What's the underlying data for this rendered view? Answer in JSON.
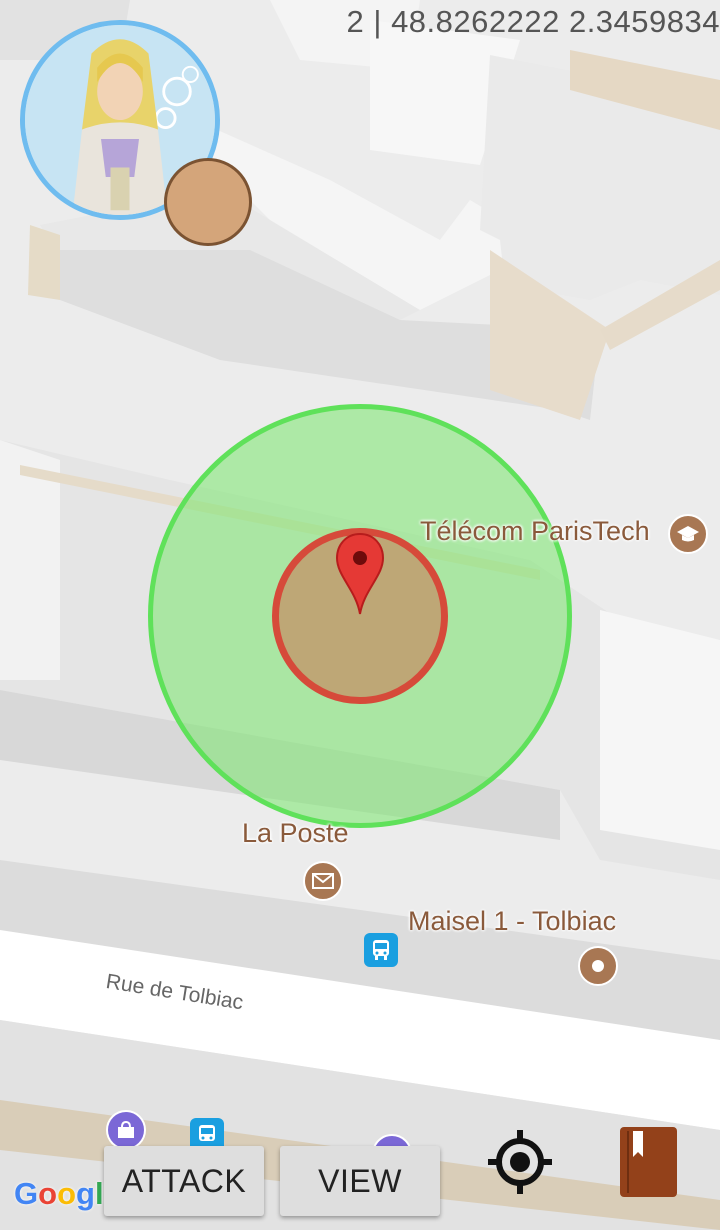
{
  "status": {
    "coords": "2 | 48.8262222 2.3459834"
  },
  "map": {
    "pois": [
      {
        "label": "Télécom ParisTech",
        "icon": "graduation-cap-icon"
      },
      {
        "label": "La Poste",
        "icon": "mail-icon"
      },
      {
        "label": "Maisel 1 - Tolbiac",
        "icon": "place-dot-icon"
      }
    ],
    "street": "Rue de Tolbiac",
    "attribution": "Google"
  },
  "actions": {
    "attack_label": "ATTACK",
    "view_label": "VIEW"
  },
  "colors": {
    "range_fill": "#7ae86e",
    "range_stroke": "#5fe15a",
    "target_stroke": "#d64a3a",
    "target_fill": "#bea776",
    "pin": "#e53935",
    "avatar_ring": "#6fbcef",
    "poi": "#a87753",
    "book": "#93411a"
  }
}
